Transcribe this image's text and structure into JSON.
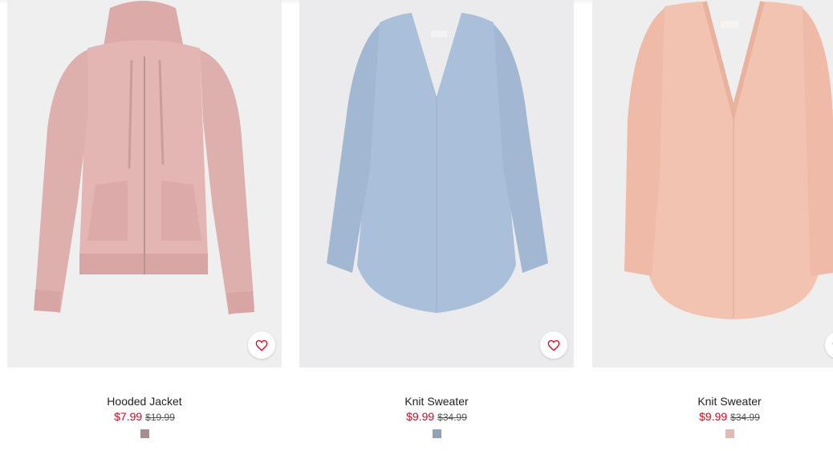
{
  "products": [
    {
      "name": "Hooded Jacket",
      "sale_price": "$7.99",
      "original_price": "$19.99",
      "swatch_color": "#a98c8c",
      "image_bg": "#f0efef",
      "garment_color": "#e3b6b4"
    },
    {
      "name": "Knit Sweater",
      "sale_price": "$9.99",
      "original_price": "$34.99",
      "swatch_color": "#8fa2b8",
      "image_bg": "#ebebed",
      "garment_color": "#a9bfda"
    },
    {
      "name": "Knit Sweater",
      "sale_price": "$9.99",
      "original_price": "$34.99",
      "swatch_color": "#e1bab4",
      "image_bg": "#efeeee",
      "garment_color": "#f3c3b1"
    }
  ],
  "colors": {
    "sale": "#e3001b",
    "heart": "#e3001b"
  }
}
